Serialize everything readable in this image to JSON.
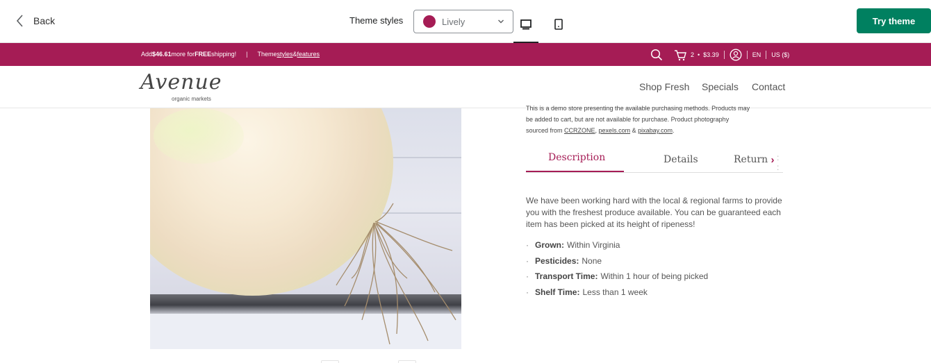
{
  "editor": {
    "back_label": "Back",
    "theme_styles_label": "Theme styles",
    "theme_style_value": "Lively",
    "theme_swatch_color": "#a51c55",
    "try_button": "Try theme",
    "try_button_color": "#008060",
    "device_desktop_icon": "desktop-icon",
    "device_mobile_icon": "tablet-icon"
  },
  "announcement": {
    "shipping_prefix": "Add ",
    "shipping_amount": "$46.61",
    "shipping_mid": " more for ",
    "shipping_free": "FREE",
    "shipping_suffix": " shipping!",
    "separator": "|",
    "theme_prefix": "Theme ",
    "theme_styles_link": "styles",
    "theme_amp": " & ",
    "theme_features_link": "features",
    "cart_count": "2",
    "cart_dot": "•",
    "cart_total": "$3.39",
    "language": "EN",
    "currency": "US ($)",
    "bar_color": "#a51c55"
  },
  "store": {
    "logo_script": "Avenue",
    "logo_sub": "organic markets",
    "nav": [
      "Shop Fresh",
      "Specials",
      "Contact"
    ]
  },
  "product": {
    "notice_line1": "This is a demo store presenting the available purchasing methods. Products may",
    "notice_line2": "be added to cart, but are not available for purchase. Product photography",
    "notice_line3_prefix": "sourced from ",
    "notice_link1": "CCRZONE",
    "notice_comma": ", ",
    "notice_link2": "pexels.com",
    "notice_amp": " & ",
    "notice_link3": "pixabay.com",
    "notice_end": ".",
    "tabs": [
      "Description",
      "Details",
      "Returns"
    ],
    "tab_overflow": ": :",
    "description": "We have been working hard with the local & regional farms to provide you with the freshest produce available. You can be guaranteed each item has been picked at its height of ripeness!",
    "attributes": [
      {
        "label": "Grown:",
        "value": "Within Virginia"
      },
      {
        "label": "Pesticides:",
        "value": "None"
      },
      {
        "label": "Transport Time:",
        "value": "Within 1 hour of being picked"
      },
      {
        "label": "Shelf Time:",
        "value": "Less than 1 week"
      }
    ],
    "bullet": "·"
  }
}
